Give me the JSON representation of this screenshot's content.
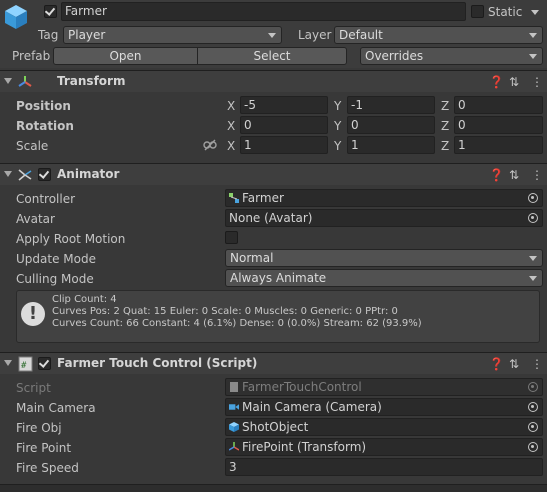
{
  "header": {
    "object_name": "Farmer",
    "static_label": "Static",
    "tag_label": "Tag",
    "tag_value": "Player",
    "layer_label": "Layer",
    "layer_value": "Default",
    "prefab_label": "Prefab",
    "open_label": "Open",
    "select_label": "Select",
    "overrides_label": "Overrides"
  },
  "transform": {
    "title": "Transform",
    "position_label": "Position",
    "rotation_label": "Rotation",
    "scale_label": "Scale",
    "x": "X",
    "y": "Y",
    "z": "Z",
    "position": {
      "x": "-5",
      "y": "-1",
      "z": "0"
    },
    "rotation": {
      "x": "0",
      "y": "0",
      "z": "0"
    },
    "scale": {
      "x": "1",
      "y": "1",
      "z": "1"
    }
  },
  "animator": {
    "title": "Animator",
    "controller_label": "Controller",
    "controller_value": "Farmer",
    "avatar_label": "Avatar",
    "avatar_value": "None (Avatar)",
    "apply_root_motion_label": "Apply Root Motion",
    "update_mode_label": "Update Mode",
    "update_mode_value": "Normal",
    "culling_mode_label": "Culling Mode",
    "culling_mode_value": "Always Animate",
    "help_lines": [
      "Clip Count: 4",
      "Curves Pos: 2 Quat: 15 Euler: 0 Scale: 0 Muscles: 0 Generic: 0 PPtr: 0",
      "Curves Count: 66 Constant: 4 (6.1%) Dense: 0 (0.0%) Stream: 62 (93.9%)"
    ]
  },
  "script_component": {
    "title": "Farmer Touch Control (Script)",
    "script_label": "Script",
    "script_value": "FarmerTouchControl",
    "main_camera_label": "Main Camera",
    "main_camera_value": "Main Camera (Camera)",
    "fire_obj_label": "Fire Obj",
    "fire_obj_value": "ShotObject",
    "fire_point_label": "Fire Point",
    "fire_point_value": "FirePoint (Transform)",
    "fire_speed_label": "Fire Speed",
    "fire_speed_value": "3"
  },
  "colors": {
    "background": "#383838",
    "field": "#2a2a2a",
    "header": "#3e3e3e",
    "cube_icon": "#4aa3df"
  }
}
